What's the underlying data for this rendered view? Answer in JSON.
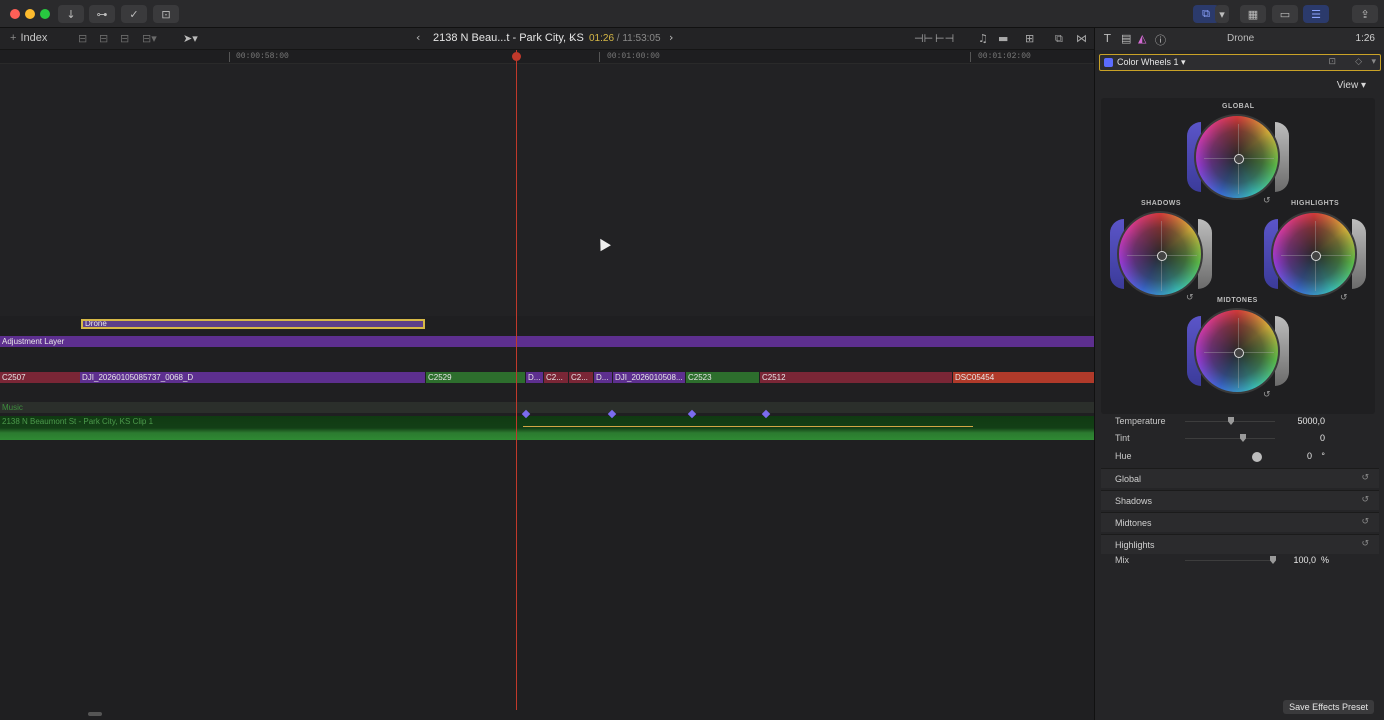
{
  "timeline_toolbar": {
    "index_label": "Index",
    "project_title": "2138 N Beau...t - Park City, KS",
    "current_time": "01:26",
    "total_time": " / 11:53:05"
  },
  "ruler": {
    "ticks": [
      "00:00:58:00",
      "00:01:00:00",
      "00:01:02:00"
    ]
  },
  "clips": {
    "drone_title": "Drone",
    "adjustment_layer": "Adjustment Layer",
    "primary": [
      {
        "label": "C2507",
        "color": "#7a2636"
      },
      {
        "label": "DJI_20260105085737_0068_D",
        "color": "#5d2f8f"
      },
      {
        "label": "C2529",
        "color": "#2d6e2d"
      },
      {
        "label": "D...",
        "color": "#5d2f8f"
      },
      {
        "label": "C2...",
        "color": "#7a2636"
      },
      {
        "label": "C2...",
        "color": "#7a2636"
      },
      {
        "label": "D...",
        "color": "#5d2f8f"
      },
      {
        "label": "DJI_2026010508...",
        "color": "#5d2f8f"
      },
      {
        "label": "C2523",
        "color": "#2d6e2d"
      },
      {
        "label": "C2512",
        "color": "#7a2636"
      },
      {
        "label": "DSC05454",
        "color": "#b03a2a"
      }
    ],
    "music_label": "Music",
    "audio_label": "2138 N Beaumont St - Park City, KS Clip 1"
  },
  "inspector": {
    "title": "Drone",
    "duration": "1:26",
    "effect_name": "Color Wheels 1",
    "view_label": "View",
    "wheels": {
      "global": "GLOBAL",
      "shadows": "SHADOWS",
      "highlights": "HIGHLIGHTS",
      "midtones": "MIDTONES"
    },
    "params": {
      "temperature_label": "Temperature",
      "temperature_value": "5000,0",
      "tint_label": "Tint",
      "tint_value": "0",
      "hue_label": "Hue",
      "hue_value": "0",
      "hue_unit": "°"
    },
    "sections": [
      "Global",
      "Shadows",
      "Midtones",
      "Highlights"
    ],
    "mix_label": "Mix",
    "mix_value": "100,0",
    "mix_unit": "%",
    "save_preset": "Save Effects Preset"
  },
  "colors": {
    "accent_yellow": "#c9a227",
    "playhead": "#c0392b",
    "purple_clip": "#5d2f8f",
    "green_clip": "#2d6e2d",
    "red_clip": "#7a2636"
  }
}
